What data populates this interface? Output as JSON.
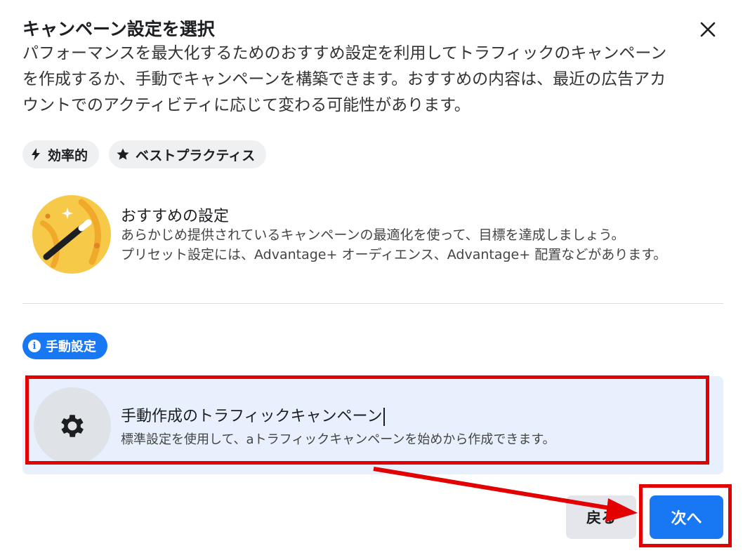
{
  "dialog": {
    "title": "キャンペーン設定を選択",
    "description": "パフォーマンスを最大化するためのおすすめ設定を利用してトラフィックのキャンペーンを作成するか、手動でキャンペーンを構築できます。おすすめの内容は、最近の広告アカウントでのアクティビティに応じて変わる可能性があります。"
  },
  "tags": [
    {
      "label": "効率的",
      "icon": "lightning-icon"
    },
    {
      "label": "ベストプラクティス",
      "icon": "star-icon"
    }
  ],
  "recommended": {
    "title": "おすすめの設定",
    "description_line1": "あらかじめ提供されているキャンペーンの最適化を使って、目標を達成しましょう。",
    "description_line2": "プリセット設定には、Advantage+ オーディエンス、Advantage+ 配置などがあります。",
    "icon": "magic-wand-icon"
  },
  "manual": {
    "badge": "手動設定",
    "title": "手動作成のトラフィックキャンペーン",
    "description": "標準設定を使用して、aトラフィックキャンペーンを始めから作成できます。",
    "icon": "gear-icon"
  },
  "buttons": {
    "back": "戻る",
    "next": "次へ"
  },
  "colors": {
    "accent": "#1877f2",
    "annotation": "#e30000",
    "selected_card": "#e7f0fc"
  }
}
